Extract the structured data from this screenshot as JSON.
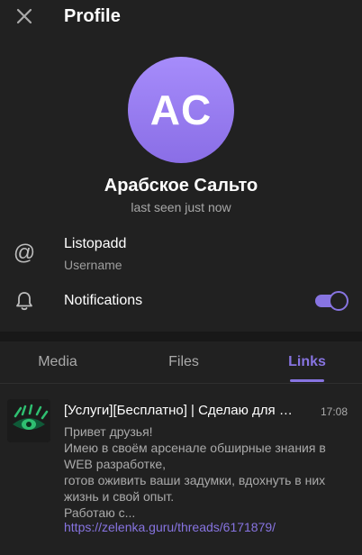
{
  "header": {
    "title": "Profile",
    "close_icon": "close-icon"
  },
  "profile": {
    "initials": "AC",
    "name": "Арабское Сальто",
    "status": "last seen just now",
    "avatar_color": "#9a80f5"
  },
  "info": {
    "username_value": "Listopadd",
    "username_label": "Username",
    "notifications_label": "Notifications",
    "notifications_enabled": true
  },
  "tabs": [
    {
      "label": "Media",
      "active": false
    },
    {
      "label": "Files",
      "active": false
    },
    {
      "label": "Links",
      "active": true
    }
  ],
  "links": [
    {
      "title": "[Услуги][Бесплатно] | Сделаю для …",
      "time": "17:08",
      "description": "Привет друзья!\nИмею в своём арсенале обширные знания в WEB разработке,\nготов оживить ваши задумки, вдохнуть в них жизнь и свой опыт.\nРаботаю с...",
      "url": "https://zelenka.guru/threads/6171879/"
    }
  ],
  "colors": {
    "accent": "#8774e1",
    "background": "#212121",
    "secondary_text": "#aaaaaa"
  }
}
